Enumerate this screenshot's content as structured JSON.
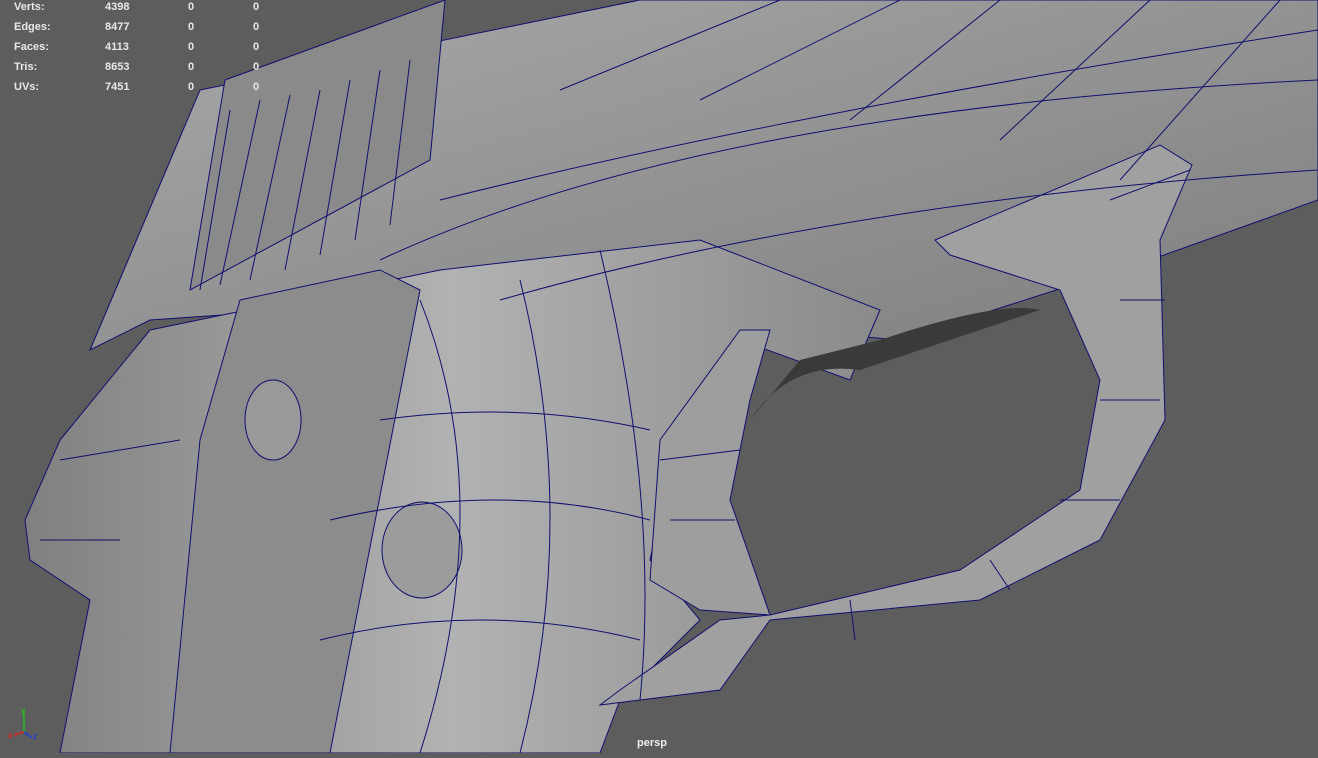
{
  "hud": {
    "rows": [
      {
        "label": "Verts:",
        "values": [
          "4398",
          "0",
          "0"
        ]
      },
      {
        "label": "Edges:",
        "values": [
          "8477",
          "0",
          "0"
        ]
      },
      {
        "label": "Faces:",
        "values": [
          "4113",
          "0",
          "0"
        ]
      },
      {
        "label": "Tris:",
        "values": [
          "8653",
          "0",
          "0"
        ]
      },
      {
        "label": "UVs:",
        "values": [
          "7451",
          "0",
          "0"
        ]
      }
    ]
  },
  "camera_label": "persp",
  "axis": {
    "x": "x",
    "y": "y",
    "z": "z"
  },
  "colors": {
    "background": "#5d5d5d",
    "mesh": "#9a9a9a",
    "wire": "#10106e",
    "axis_x": "#e02020",
    "axis_y": "#20c020",
    "axis_z": "#2040e0"
  }
}
